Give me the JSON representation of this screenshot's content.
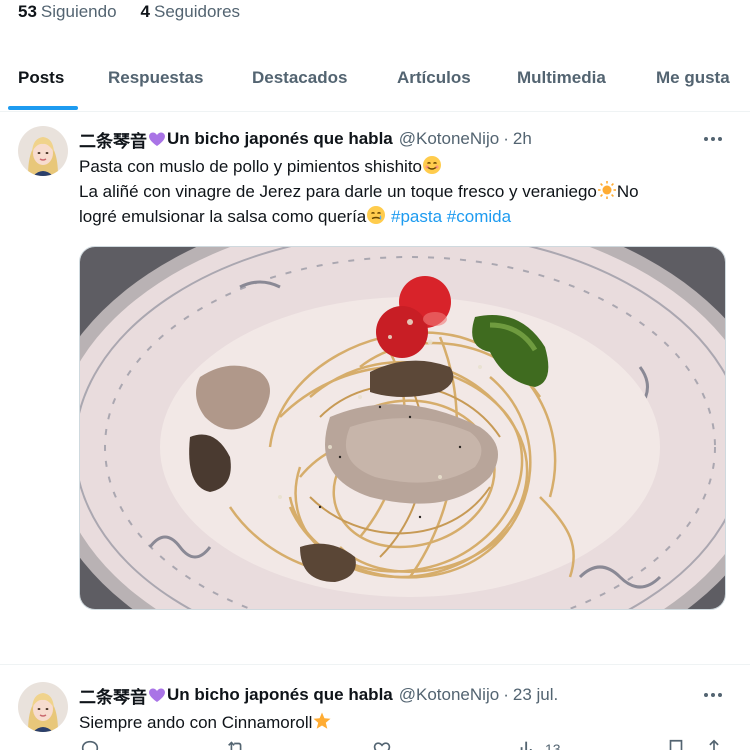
{
  "profile": {
    "following_count": "53",
    "following_label": "Siguiendo",
    "followers_count": "4",
    "followers_label": "Seguidores"
  },
  "tabs": [
    {
      "label": "Posts",
      "active": true
    },
    {
      "label": "Respuestas"
    },
    {
      "label": "Destacados"
    },
    {
      "label": "Artículos"
    },
    {
      "label": "Multimedia"
    },
    {
      "label": "Me gusta"
    }
  ],
  "tweets": [
    {
      "name": "二条琴音",
      "name_suffix": "Un bicho japonés que habla",
      "handle": "@KotoneNijo",
      "dot": "·",
      "time": "2h",
      "line1": "Pasta con muslo de pollo y pimientos shishito",
      "line2": " La aliñé con vinagre de Jerez para darle un toque fresco y veraniego",
      "line2_end": "No",
      "line3": "logré emulsionar la salsa como quería",
      "hashtags": [
        "#pasta",
        "#comida"
      ],
      "views": "13",
      "icons": [
        "purple-heart-icon",
        "smiling-face-icon",
        "sun-icon",
        "crying-face-icon"
      ]
    },
    {
      "name": "二条琴音",
      "name_suffix": "Un bicho japonés que habla",
      "handle": "@KotoneNijo",
      "dot": "·",
      "time": "23 jul.",
      "line1": "Siempre ando con Cinnamoroll",
      "icons": [
        "purple-heart-icon",
        "star-icon"
      ]
    }
  ],
  "actions": [
    "reply-icon",
    "repost-icon",
    "like-icon",
    "views-icon",
    "bookmark-icon",
    "share-icon"
  ],
  "colors": {
    "accent": "#1d9bf0",
    "text": "#0f1419",
    "muted": "#536471",
    "purple_heart": "#a974e6",
    "border": "#eff3f4"
  }
}
